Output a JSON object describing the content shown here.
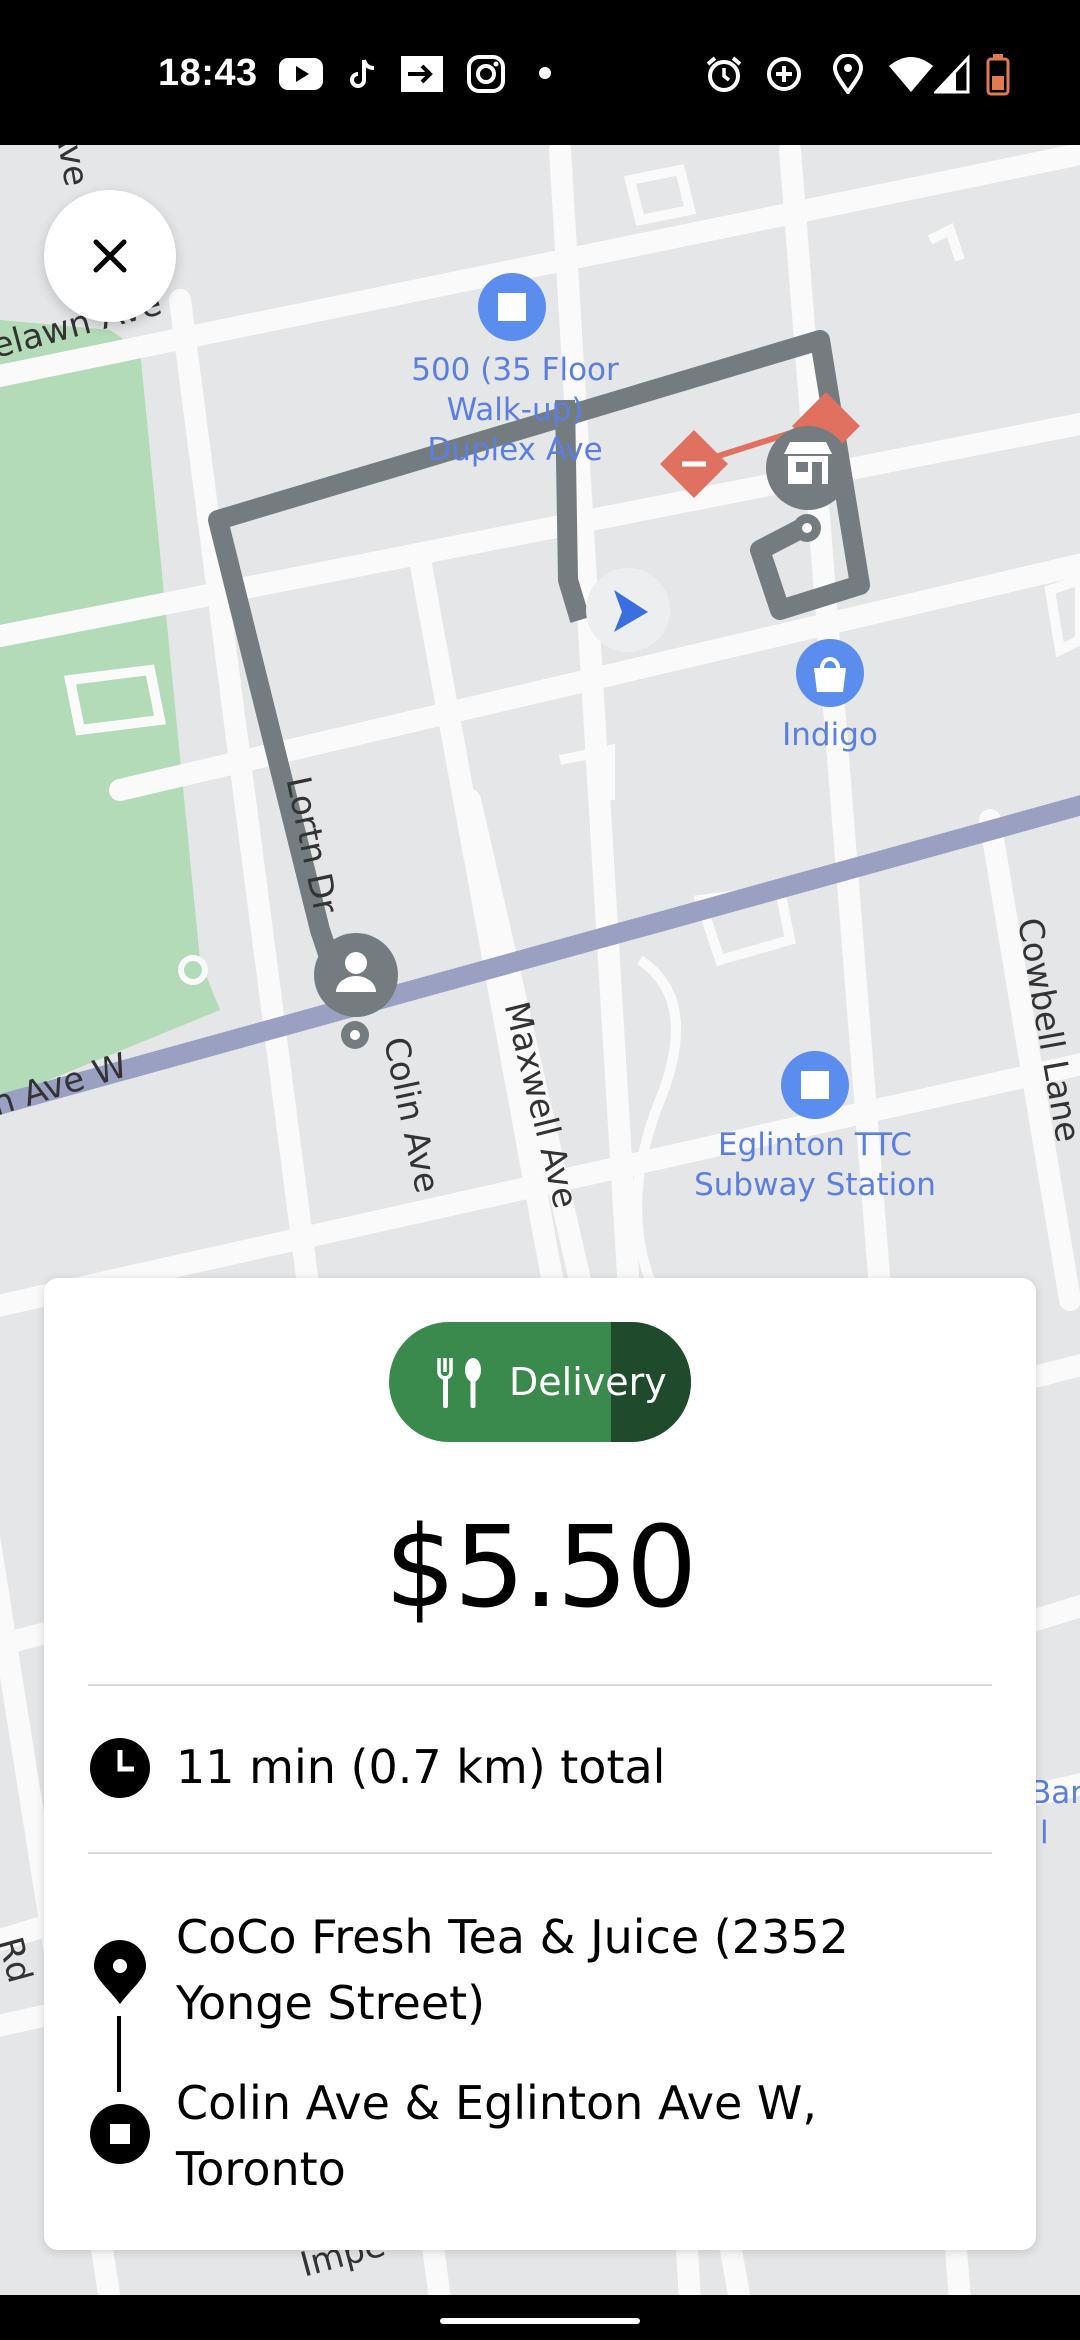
{
  "status_bar": {
    "time": "18:43",
    "left_icons": [
      "youtube-icon",
      "tiktok-icon",
      "cast-icon",
      "instagram-icon",
      "dot-icon"
    ],
    "right_icons": [
      "alarm-icon",
      "data-saver-icon",
      "location-icon",
      "wifi-icon",
      "signal-icon",
      "battery-icon"
    ]
  },
  "map": {
    "places": [
      {
        "label": "500 (35 Floor Walk-up) Duplex Ave",
        "icon": "building-icon"
      },
      {
        "label": "Indigo",
        "icon": "shopping-bag-icon"
      },
      {
        "label": "Eglinton TTC Subway Station",
        "icon": "transit-icon"
      }
    ],
    "streets": [
      "elawn Ave",
      "Ave",
      "Lortn Dr",
      "Colin Ave",
      "Maxwell Ave",
      "Cowbell Lane",
      "n Ave W",
      "Rd",
      "Impe",
      "Bar",
      "l"
    ],
    "colors": {
      "route": "#747c80",
      "park": "#b3dbb8",
      "rail": "#9aa0c2",
      "poi": "#5b8def"
    }
  },
  "close_button": {
    "icon": "close-icon"
  },
  "card": {
    "tag": {
      "label": "Delivery",
      "icon": "utensils-icon",
      "color": "#3a8a4e"
    },
    "price": "$5.50",
    "duration": "11 min (0.7 km) total",
    "pickup": "CoCo Fresh Tea & Juice (2352 Yonge Street)",
    "dropoff": "Colin Ave & Eglinton Ave W, Toronto"
  }
}
